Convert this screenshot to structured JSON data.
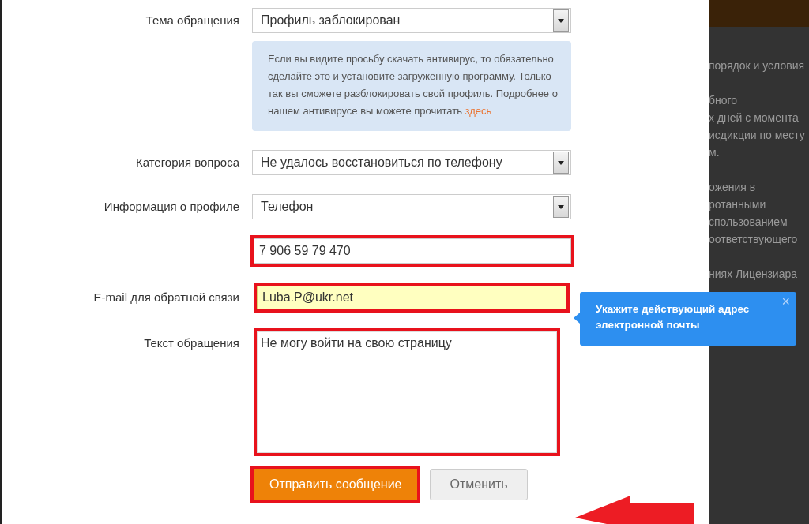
{
  "form": {
    "rows": [
      {
        "kind": "select",
        "label": "Тема обращения",
        "value": "Профиль заблокирован",
        "highlighted": false
      },
      {
        "kind": "notice",
        "text": "Если вы видите просьбу скачать антивирус, то обязательно сделайте это и установите загруженную программу. Только так вы сможете разблокировать свой профиль. Подробнее о нашем антивирусе вы можете прочитать",
        "link": "здесь"
      },
      {
        "kind": "select",
        "label": "Категория вопроса",
        "value": "Не удалось восстановиться по телефону",
        "highlighted": false
      },
      {
        "kind": "select",
        "label": "Информация о профиле",
        "value": "Телефон",
        "highlighted": false
      },
      {
        "kind": "input",
        "value": "7 906 59 79 470",
        "highlighted": true,
        "invalid": false
      },
      {
        "kind": "input",
        "label": "E-mail для обратной связи",
        "value": "Luba.P@ukr.net",
        "highlighted": true,
        "invalid": true
      },
      {
        "kind": "textarea",
        "label": "Текст обращения",
        "value": "Не могу войти на свою страницу",
        "highlighted": true
      }
    ],
    "buttons": [
      {
        "label": "Отправить сообщение",
        "kind": "primary",
        "highlighted": true
      },
      {
        "label": "Отменить",
        "kind": "secondary",
        "highlighted": false
      }
    ]
  },
  "tooltip": {
    "text": "Укажите действующий адрес электронной почты",
    "close": "×"
  },
  "background_text": [
    "порядок и условия",
    "бного",
    "х дней с момента",
    "исдикции по месту",
    "м.",
    "ожения в",
    "ротанными",
    "спользованием",
    "оответствующего",
    "ниях Лицензиара"
  ]
}
